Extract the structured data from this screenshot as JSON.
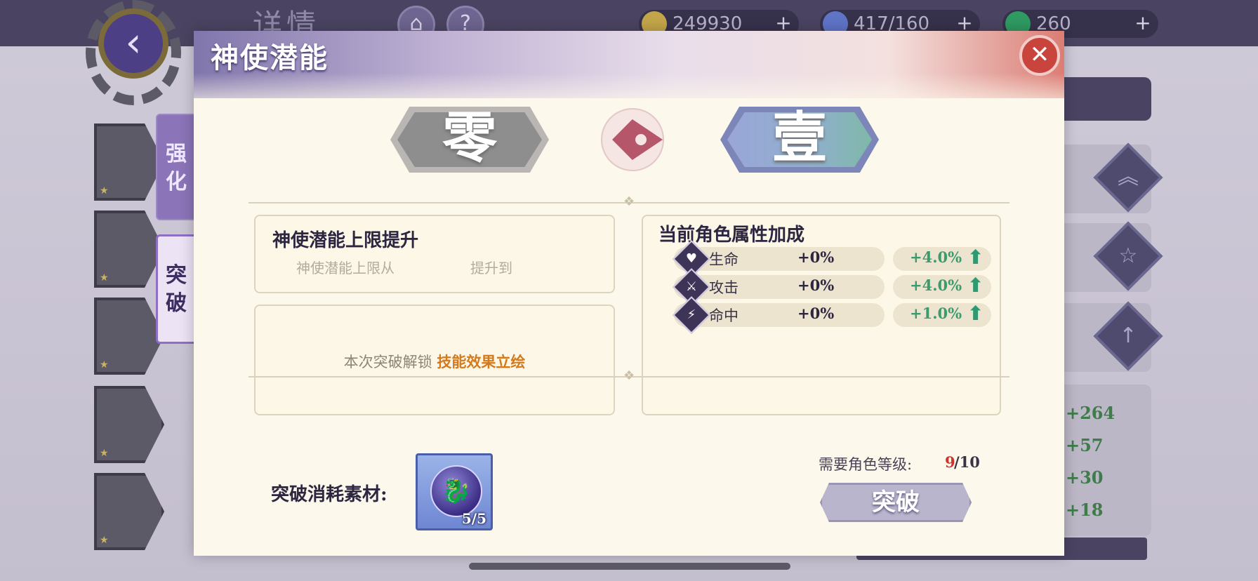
{
  "background": {
    "page_title": "详情",
    "currency": [
      {
        "icon": "coin-icon",
        "value": "249930",
        "color": "#c3a64a"
      },
      {
        "icon": "stamina-icon",
        "value": "417/160",
        "color": "#5f74c7"
      },
      {
        "icon": "jade-icon",
        "value": "260",
        "color": "#2f9a62"
      }
    ],
    "stat_bonuses": [
      "+264",
      "+57",
      "+30",
      "+18"
    ]
  },
  "side_tabs": {
    "strengthen": "强化",
    "breakthrough": "突破"
  },
  "dialog": {
    "title": "神使潜能",
    "close_icon": "✕",
    "rank_current": "零",
    "rank_next": "壹",
    "limit_panel": {
      "title": "神使潜能上限提升",
      "from_text": "神使潜能上限从",
      "to_text": "提升到"
    },
    "unlock_panel": {
      "prefix": "本次突破解锁",
      "highlight": "技能效果立绘"
    },
    "attr_panel": {
      "title": "当前角色属性加成",
      "rows": [
        {
          "icon": "heart-icon",
          "glyph": "♥",
          "name": "生命",
          "current": "+0%",
          "next": "+4.0%"
        },
        {
          "icon": "sword-icon",
          "glyph": "⚔",
          "name": "攻击",
          "current": "+0%",
          "next": "+4.0%"
        },
        {
          "icon": "lightning-icon",
          "glyph": "⚡",
          "name": "命中",
          "current": "+0%",
          "next": "+1.0%"
        }
      ]
    },
    "materials": {
      "label": "突破消耗素材:",
      "item_icon": "dragon-orb-icon",
      "item_count": "5/5"
    },
    "requirement": {
      "label": "需要角色等级:",
      "current": "9",
      "rest": "/10"
    },
    "break_button": "突破",
    "accent_colors": {
      "highlight": "#d47a1c",
      "level_current": "#d2322b",
      "attr_increase": "#3d9a6f"
    }
  }
}
